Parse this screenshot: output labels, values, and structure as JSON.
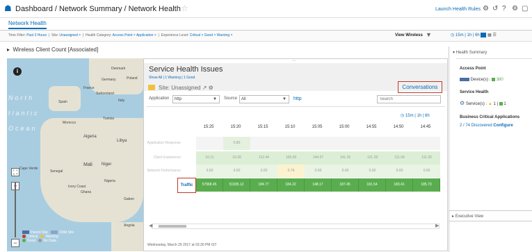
{
  "header": {
    "breadcrumb": "Dashboard / Network Summary / Network Health",
    "launch_rules": "Launch Health Rules"
  },
  "tabs": [
    "Network Health"
  ],
  "filter_bar": {
    "time_filter_label": "Time Filter:",
    "time_filter_value": "Past 3 Hours",
    "site_label": "Site:",
    "site_value": "Unassigned ×",
    "health_category_label": "Health Category:",
    "health_category_values": [
      "Access Point ×",
      "Application ×"
    ],
    "experience_level_label": "Experience Level:",
    "experience_level_values": [
      "Critical ×",
      "Good ×",
      "Warning ×"
    ],
    "view_wireless": "View Wireless"
  },
  "time_ranges": [
    "15m",
    "1h",
    "6h"
  ],
  "section": {
    "wireless_client_count": "Wireless Client Count [Associated]"
  },
  "map": {
    "ocean_label_1": "North",
    "ocean_label_2": "tlantic",
    "ocean_label_3": "Ocean",
    "place_labels": [
      "Denmark",
      "Germany",
      "Poland",
      "France",
      "Switzerland",
      "Italy",
      "Spain",
      "Tunisia",
      "Morocco",
      "Algeria",
      "Libya",
      "Mali",
      "Niger",
      "Senegal",
      "Nigeria",
      "Ivory Coast",
      "Ghana",
      "Gabon",
      "Angola",
      "Cape Verde"
    ],
    "legend": [
      "Parent Site",
      "Child Site",
      "Critical",
      "Warning",
      "Good",
      "No Data"
    ]
  },
  "service_health": {
    "title": "Service Health Issues",
    "counts": "Show All  |  1 Warning  |  1 Good",
    "site_label": "Site: Unassigned",
    "conversations_button": "Conversations",
    "application_label": "Application",
    "application_value": "http",
    "source_label": "Source",
    "source_value": "All",
    "http_link": "http",
    "search_placeholder": "Search",
    "time_ranges": "15m | 1h | 6h",
    "columns": [
      "15:25",
      "15:20",
      "15:15",
      "15:10",
      "15:05",
      "15:00",
      "14:55",
      "14:50",
      "14:45"
    ],
    "rows": [
      {
        "label": "Application Response",
        "values": [
          "",
          "0.80",
          "",
          "",
          "",
          "",
          "",
          "",
          ""
        ]
      },
      {
        "label": "Client Experience",
        "values": [
          "10.11",
          "10.28",
          "112.44",
          "106.09",
          "144.07",
          "141.25",
          "121.28",
          "111.04",
          "111.30"
        ]
      },
      {
        "label": "Network Performance",
        "values": [
          "0.00",
          "0.00",
          "0.00",
          "0.76",
          "0.00",
          "0.00",
          "0.00",
          "0.00",
          "0.00"
        ]
      },
      {
        "label": "Traffic",
        "values": [
          "57968.45",
          "51935.12",
          "184.77",
          "184.22",
          "148.17",
          "187.45",
          "181.54",
          "183.41",
          "185.73"
        ]
      }
    ],
    "footer": "Wednesday, March 29 2017 at 03:30 PM IST"
  },
  "right_panel": {
    "health_summary": "Health Summary",
    "access_point": "Access Point",
    "device_count": "Device(s) : ",
    "device_value": "380",
    "service_health": "Service Health",
    "service_label": "Service(s) :",
    "service_warning": "1",
    "service_good": "1",
    "business_critical": "Business Critical Applications",
    "discovered": "2 / 74 Discovered",
    "configure": "Configure",
    "executive_view": "Executive View"
  },
  "colors": {
    "accent": "#0a6bb5",
    "traffic_green": "#5aad4e",
    "light_green": "#dcefd6",
    "warning_yellow": "#fbf3d0",
    "highlight_red": "#c0392b"
  }
}
